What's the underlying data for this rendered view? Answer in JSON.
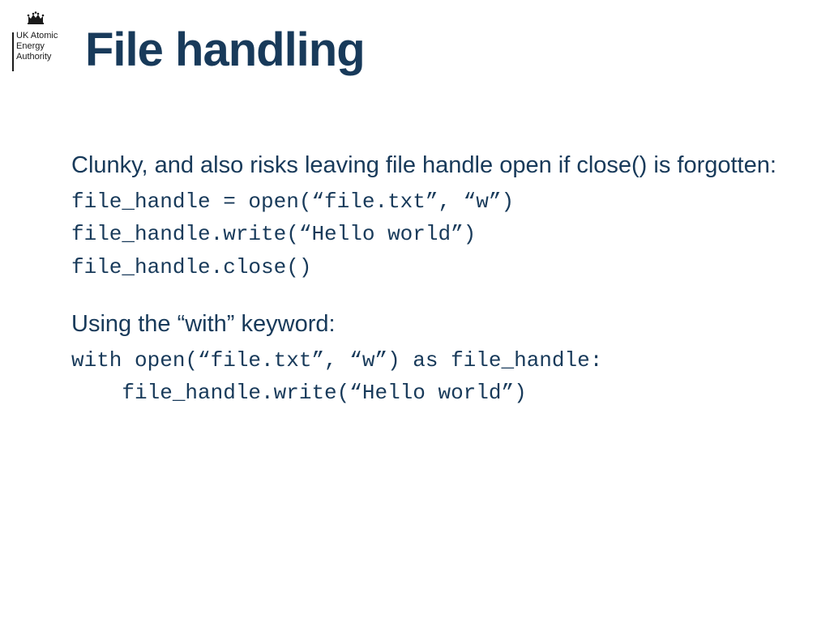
{
  "logo": {
    "line1": "UK Atomic",
    "line2": "Energy",
    "line3": "Authority"
  },
  "title": "File handling",
  "section1": {
    "intro": "Clunky, and also risks leaving file handle open if close() is forgotten:",
    "code": [
      "file_handle = open(“file.txt”, “w”)",
      "file_handle.write(“Hello world”)",
      "file_handle.close()"
    ]
  },
  "section2": {
    "intro": "Using the “with” keyword:",
    "code": [
      "with open(“file.txt”, “w”) as file_handle:",
      "    file_handle.write(“Hello world”)"
    ]
  }
}
